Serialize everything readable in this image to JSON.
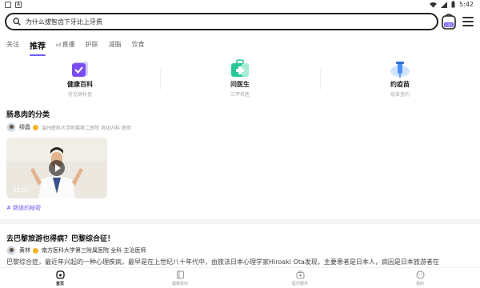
{
  "status_bar": {
    "time": "5:42",
    "left_icons": [
      "notification-icon",
      "app-icon"
    ],
    "right_icons": [
      "wifi-icon",
      "signal-icon",
      "battery-icon"
    ]
  },
  "search": {
    "query": "为什么拔智齿下牙比上牙费",
    "scan_label": "扫码"
  },
  "tabs": [
    {
      "label": "关注",
      "active": false
    },
    {
      "label": "推荐",
      "active": true
    },
    {
      "label": "直播",
      "active": false
    },
    {
      "label": "护肤",
      "active": false
    },
    {
      "label": "减脂",
      "active": false
    },
    {
      "label": "饮食",
      "active": false
    }
  ],
  "services": [
    {
      "title": "健康百科",
      "subtitle": "常见病科普",
      "icon": "book-check-icon"
    },
    {
      "title": "问医生",
      "subtitle": "三甲名医",
      "icon": "medical-kit-icon"
    },
    {
      "title": "约疫苗",
      "subtitle": "疫苗查约",
      "icon": "vaccine-icon"
    }
  ],
  "feed": {
    "post1": {
      "title": "肠息肉的分类",
      "author": "缪晶",
      "author_meta": "温州医科大学附属第二医院 消化内科 医师",
      "duration": "01:01",
      "topic": "# 肠道的秘密"
    },
    "post2": {
      "title": "去巴黎旅游也得病？巴黎综合征！",
      "author": "黄林",
      "author_meta": "南方医科大学第三附属医院 全科 主治医师",
      "excerpt": "巴黎综合症，最近年兴起的一种心理疾病，最早是在上世纪八十年代中，由旅法日本心理学家Hiroaki Ota发现，主要患者是日本人，病因是日本旅游者在"
    }
  },
  "bottom_nav": [
    {
      "label": "首页",
      "icon": "home-icon",
      "active": true
    },
    {
      "label": "健康百科",
      "icon": "encyclopedia-icon",
      "active": false
    },
    {
      "label": "医疗服务",
      "icon": "medical-service-icon",
      "active": false
    },
    {
      "label": "我的",
      "icon": "profile-icon",
      "active": false
    }
  ],
  "colors": {
    "accent": "#6b5cf5",
    "badge": "#f3b322",
    "svc_check": "#7b4df0",
    "svc_kit": "#27c79a",
    "svc_vaccine": "#4a90f0"
  }
}
